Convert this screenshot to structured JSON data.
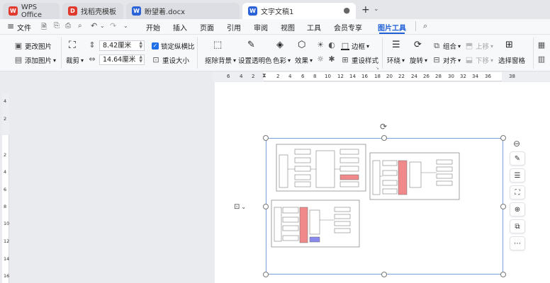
{
  "tabs": [
    {
      "label": "WPS Office",
      "icon": "wps-logo-icon",
      "color": "#e03a2f"
    },
    {
      "label": "找稻壳模板",
      "icon": "docer-icon",
      "color": "#e03a2f"
    },
    {
      "label": "盼望着.docx",
      "icon": "word-doc-icon",
      "color": "#2b62d8"
    },
    {
      "label": "文字文稿1",
      "icon": "word-doc-icon",
      "color": "#2b62d8"
    }
  ],
  "menu": {
    "file": "文件",
    "items": [
      "开始",
      "插入",
      "页面",
      "引用",
      "审阅",
      "视图",
      "工具",
      "会员专享",
      "图片工具"
    ],
    "active": "图片工具"
  },
  "ribbon": {
    "change_picture": "更改图片",
    "add_picture": "添加图片",
    "crop": "裁剪",
    "height_value": "8.42厘米",
    "width_value": "14.64厘米",
    "lock_ratio": "锁定纵横比",
    "reset_size": "重设大小",
    "remove_background": "抠除背景",
    "set_transparent": "设置透明色",
    "color": "色彩",
    "effects": "效果",
    "border": "边框",
    "reset_style": "重设样式",
    "wrap": "环绕",
    "rotate": "旋转",
    "group": "组合",
    "align": "对齐",
    "move_up": "上移",
    "move_down": "下移",
    "selection_pane": "选择窗格"
  },
  "hruler_numbers": [
    "6",
    "4",
    "2",
    "2",
    "4",
    "6",
    "8",
    "10",
    "12",
    "14",
    "16",
    "18",
    "20",
    "22",
    "24",
    "26",
    "28",
    "30",
    "32",
    "34",
    "36",
    "38"
  ],
  "vruler_numbers": [
    "4",
    "2",
    "2",
    "4",
    "6",
    "8",
    "10",
    "12",
    "14",
    "16"
  ],
  "colors": {
    "accent": "#1f5fd6",
    "highlight_red": "#f08a8a",
    "highlight_purple": "#8a8aee"
  }
}
